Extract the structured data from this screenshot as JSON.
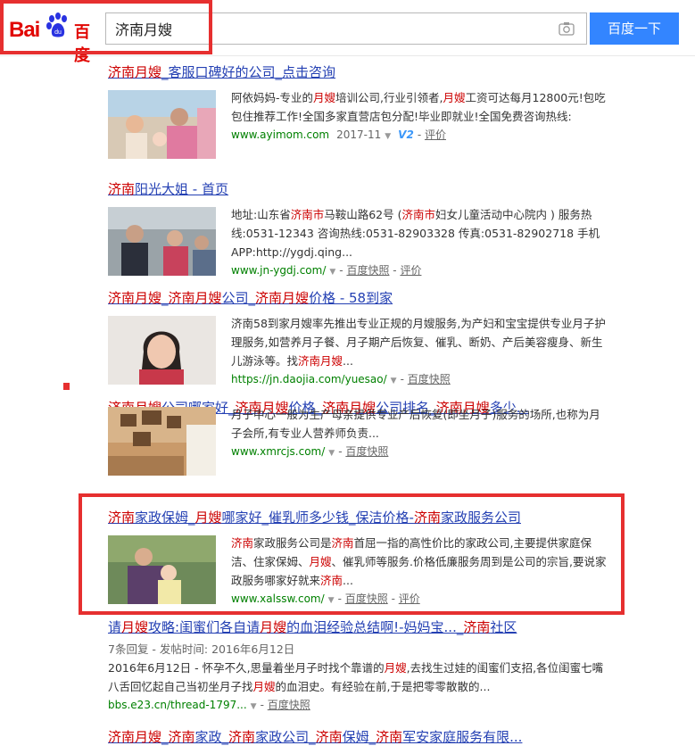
{
  "search": {
    "query": "济南月嫂",
    "button_label": "百度一下"
  },
  "logo": {
    "bai": "Bai",
    "du": "百度",
    "paw": "du"
  },
  "results": [
    {
      "title": [
        "济南月嫂",
        "_客服口碑好的公司_点击咨询"
      ],
      "desc": [
        "阿依妈妈-专业的",
        "月嫂",
        "培训公司,行业引领者,",
        "月嫂",
        "工资可达每月12800元!包吃包住推荐工作!全国多家直营店包分配!毕业即就业!全国免费咨询热线:"
      ],
      "url": "www.ayimom.com",
      "date": "2017-11",
      "v2": "V2",
      "links": [
        "评价"
      ]
    },
    {
      "title": [
        "济南",
        "阳光大姐 - 首页"
      ],
      "desc": [
        "地址:山东省",
        "济南市",
        "马鞍山路62号 (",
        "济南市",
        "妇女儿童活动中心院内 ) 服务热线:0531-12343 咨询热线:0531-82903328 传真:0531-82902718 手机APP:http://ygdj.qing..."
      ],
      "url": "www.jn-ygdj.com/",
      "links": [
        "百度快照",
        "评价"
      ]
    },
    {
      "title": [
        "济南月嫂",
        "_",
        "济南月嫂",
        "公司_",
        "济南月嫂",
        "价格 - 58到家"
      ],
      "desc": [
        "济南58到家月嫂率先推出专业正规的月嫂服务,为产妇和宝宝提供专业月子护理服务,如营养月子餐、月子期产后恢复、催乳、断奶、产后美容瘦身、新生儿游泳等。找",
        "济南月嫂",
        "..."
      ],
      "url": "https://jn.daojia.com/yuesao/",
      "links": [
        "百度快照"
      ]
    },
    {
      "title": [
        "济南月嫂",
        "公司哪家好_",
        "济南月嫂",
        "价格_",
        "济南月嫂",
        "公司排名_",
        "济南月嫂",
        "多少..."
      ],
      "desc": [
        "月子中心一般为生产母亲提供专业产后恢复(即坐月子)服务的场所,也称为月子会所,有专业人营养师负责..."
      ],
      "url": "www.xmrcjs.com/",
      "links": [
        "百度快照"
      ]
    },
    {
      "title": [
        "济南",
        "家政保姆_",
        "月嫂",
        "哪家好_催乳师多少钱_保洁价格-",
        "济南",
        "家政服务公司"
      ],
      "desc": [
        "济南",
        "家政服务公司是",
        "济南",
        "首屈一指的高性价比的家政公司,主要提供家庭保洁、住家保姆、",
        "月嫂",
        "、催乳师等服务.价格低廉服务周到是公司的宗旨,要说家政服务哪家好就来",
        "济南",
        "..."
      ],
      "url": "www.xalssw.com/",
      "links": [
        "百度快照",
        "评价"
      ]
    },
    {
      "title": [
        "请",
        "月嫂",
        "攻略:闺蜜们各自请",
        "月嫂",
        "的血泪经验总结啊!-妈妈宝..._",
        "济南",
        "社区"
      ],
      "sub": "7条回复 - 发帖时间: 2016年6月12日",
      "desc": [
        "2016年6月12日 - 怀孕不久,思量着坐月子时找个靠谱的",
        "月嫂",
        ",去找生过娃的闺蜜们支招,各位闺蜜七嘴八舌回忆起自己当初坐月子找",
        "月嫂",
        "的血泪史。有经验在前,于是把零零散散的..."
      ],
      "url": "bbs.e23.cn/thread-1797...",
      "links": [
        "百度快照"
      ]
    },
    {
      "title": [
        "济南月嫂",
        "_",
        "济南",
        "家政_",
        "济南",
        "家政公司_",
        "济南",
        "保姆_",
        "济南",
        "军安家庭服务有限..."
      ]
    }
  ]
}
